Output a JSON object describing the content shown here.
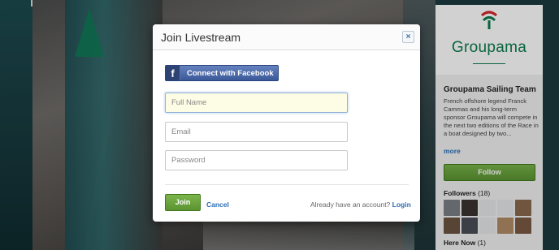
{
  "modal": {
    "title": "Join Livestream",
    "close_glyph": "×",
    "facebook_button": {
      "icon_glyph": "f",
      "label": "Connect with Facebook"
    },
    "fields": {
      "full_name": {
        "placeholder": "Full Name",
        "value": ""
      },
      "email": {
        "placeholder": "Email",
        "value": ""
      },
      "password": {
        "placeholder": "Password",
        "value": ""
      }
    },
    "join_label": "Join",
    "cancel_label": "Cancel",
    "already_text": "Already have an account?",
    "login_label": "Login"
  },
  "sidebar": {
    "brand": "Groupama",
    "team_name": "Groupama Sailing Team",
    "description": "French offshore legend Franck Cammas and his long-term sponsor Groupama will compete in the next two editions of the Race in a boat designed by two...",
    "more_label": "more",
    "follow_label": "Follow",
    "followers_label": "Followers",
    "followers_count": "(18)",
    "here_now_label": "Here Now",
    "here_now_count": "(1)",
    "follower_avatars": [
      {
        "icon": "user-avatar",
        "color": "#7b7f86"
      },
      {
        "icon": "user-avatar",
        "color": "#3a3430"
      },
      {
        "icon": "default-avatar",
        "color": "#e4e7ea"
      },
      {
        "icon": "default-avatar",
        "color": "#e4e7ea"
      },
      {
        "icon": "user-avatar",
        "color": "#8a6a4e"
      },
      {
        "icon": "user-avatar",
        "color": "#6b5440"
      },
      {
        "icon": "user-avatar",
        "color": "#4a4e55"
      },
      {
        "icon": "default-avatar",
        "color": "#e4e7ea"
      },
      {
        "icon": "user-avatar",
        "color": "#b08a66"
      },
      {
        "icon": "user-avatar",
        "color": "#7a5a44"
      }
    ]
  },
  "colors": {
    "accent_green": "#5a9431",
    "link_blue": "#2a6db5",
    "facebook_blue": "#3b5998",
    "brand_green": "#0b7a4c"
  }
}
